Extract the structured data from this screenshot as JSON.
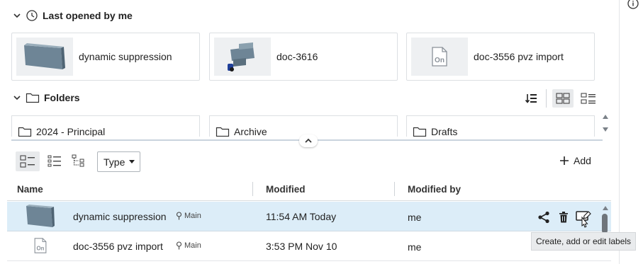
{
  "recent": {
    "heading": "Last opened by me",
    "items": [
      {
        "label": "dynamic suppression",
        "thumb": "part-thumbnail"
      },
      {
        "label": "doc-3616",
        "thumb": "assembly-thumbnail"
      },
      {
        "label": "doc-3556 pvz import",
        "thumb": "onshape-doc-icon"
      }
    ]
  },
  "folders": {
    "heading": "Folders",
    "items": [
      {
        "label": "2024 - Principal"
      },
      {
        "label": "Archive"
      },
      {
        "label": "Drafts"
      }
    ]
  },
  "toolbar": {
    "type_filter": "Type",
    "add_label": "Add"
  },
  "table": {
    "columns": [
      "Name",
      "Modified",
      "Modified by"
    ],
    "rows": [
      {
        "name": "dynamic suppression",
        "branch": "Main",
        "modified": "11:54 AM Today",
        "modified_by": "me",
        "selected": true
      },
      {
        "name": "doc-3556 pvz import",
        "branch": "Main",
        "modified": "3:53 PM Nov 10",
        "modified_by": "me",
        "selected": false
      }
    ]
  },
  "tooltip": "Create, add or edit labels",
  "colors": {
    "selected_row": "#dcedf8",
    "border": "#dcdfe3",
    "accent": "#2a6ebb"
  }
}
